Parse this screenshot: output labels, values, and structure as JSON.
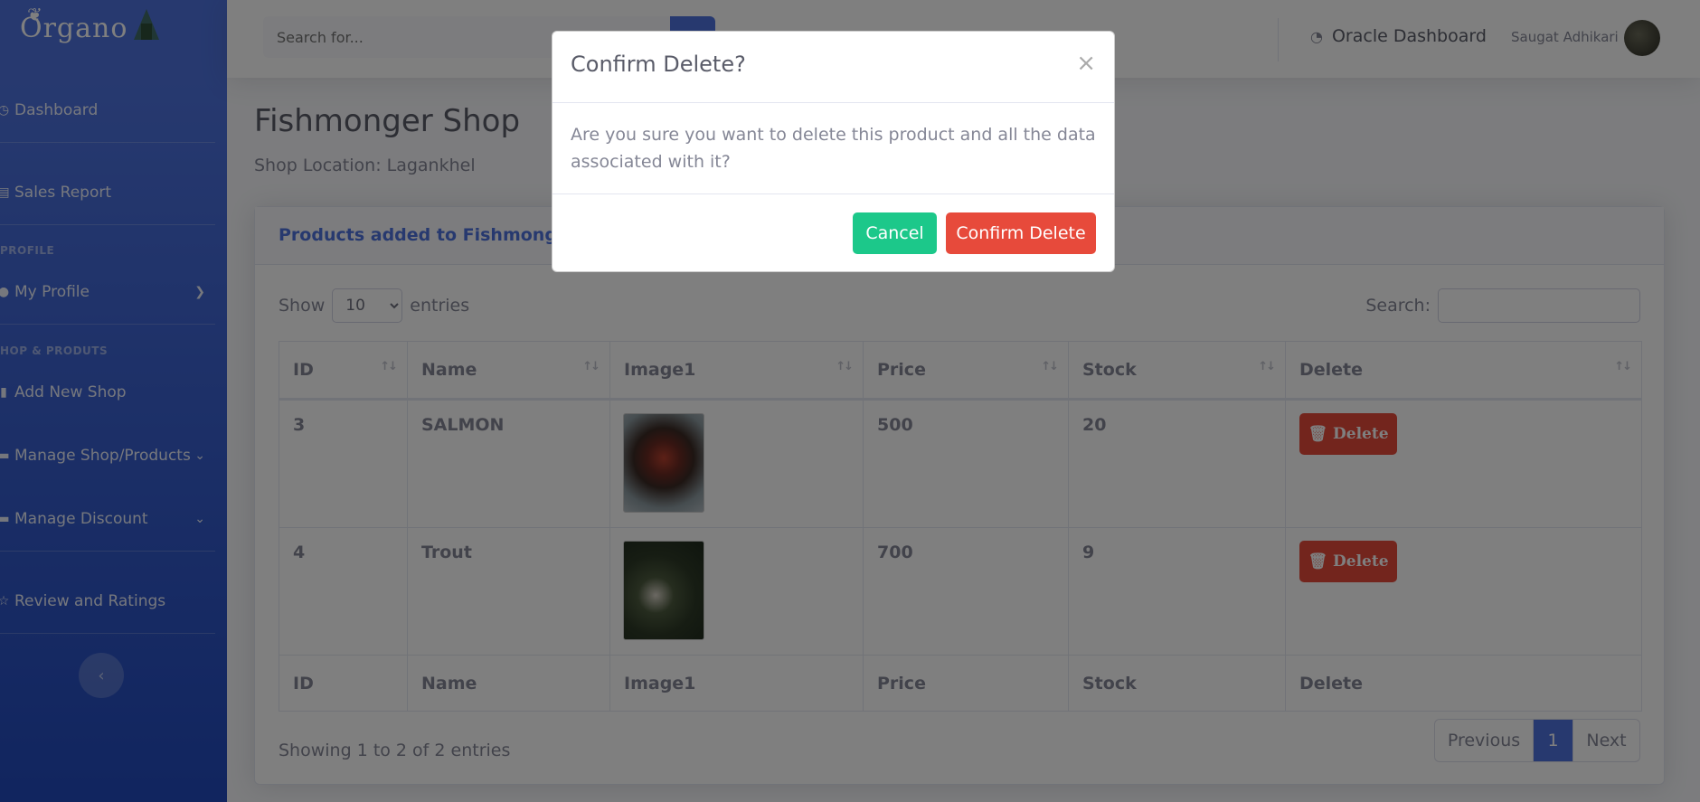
{
  "app": {
    "logo_text": "Organo"
  },
  "sidebar": {
    "items": [
      {
        "label": "Dashboard",
        "icon": "dashboard-icon"
      },
      {
        "label": "Sales Report",
        "icon": "report-icon"
      },
      {
        "label": "My Profile",
        "icon": "user-icon"
      },
      {
        "label": "Add New Shop",
        "icon": "shop-icon"
      },
      {
        "label": "Manage Shop/Products",
        "icon": "folder-icon"
      },
      {
        "label": "Manage Discount",
        "icon": "folder-icon"
      },
      {
        "label": "Review and Ratings",
        "icon": "star-icon"
      }
    ],
    "headings": [
      "PROFILE",
      "HOP & PRODUTS"
    ]
  },
  "topbar": {
    "search_placeholder": "Search for...",
    "oracle_label": "Oracle Dashboard",
    "user_name": "Saugat Adhikari"
  },
  "page": {
    "title": "Fishmonger Shop",
    "shop_location": "Shop Location: Lagankhel",
    "card_title": "Products added to Fishmonger Shop",
    "show_label": "Show",
    "entries_value": "10",
    "entries_label": "entries",
    "search_label": "Search:"
  },
  "table": {
    "columns": [
      "ID",
      "Name",
      "Image1",
      "Price",
      "Stock",
      "Delete"
    ],
    "rows": [
      {
        "id": "3",
        "name": "SALMON",
        "price": "500",
        "stock": "20",
        "delete_label": "Delete"
      },
      {
        "id": "4",
        "name": "Trout",
        "price": "700",
        "stock": "9",
        "delete_label": "Delete"
      }
    ],
    "info": "Showing 1 to 2 of 2 entries",
    "pagination": {
      "previous": "Previous",
      "current": "1",
      "next": "Next"
    }
  },
  "modal": {
    "title": "Confirm Delete?",
    "close": "×",
    "body": "Are you sure you want to delete this product and all the data associated with it?",
    "cancel_label": "Cancel",
    "confirm_label": "Confirm Delete"
  },
  "colors": {
    "primary": "#4e73df",
    "danger": "#e74a3b",
    "success": "#1cc88a"
  }
}
